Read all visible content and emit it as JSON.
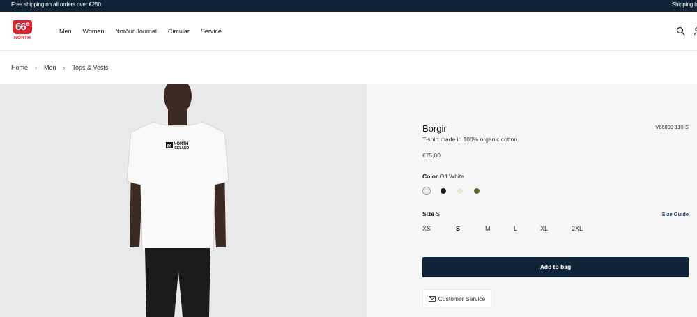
{
  "topbar": {
    "left_text": "Free shipping on all orders over €250.",
    "right_text": "Shipping to E"
  },
  "brand": {
    "logo_mark": "66°",
    "logo_word": "NORTH",
    "accent": "#d7262f",
    "navy": "#0e2238"
  },
  "nav": {
    "items": [
      "Men",
      "Women",
      "Norður Journal",
      "Circular",
      "Service"
    ]
  },
  "header_icons": [
    "search-icon",
    "user-icon"
  ],
  "breadcrumb": {
    "items": [
      "Home",
      "Men",
      "Tops & Vests"
    ],
    "separator": "›"
  },
  "product": {
    "name": "Borgir",
    "sku": "V66099-110-S",
    "description": "T-shirt made in 100% organic cotton.",
    "price": "€75,00",
    "color_label": "Color",
    "color_value": "Off White",
    "swatches": [
      {
        "name": "Off White",
        "hex": "#f2f0ea",
        "selected": true
      },
      {
        "name": "Black",
        "hex": "#1f1f1f",
        "selected": false
      },
      {
        "name": "Cream",
        "hex": "#ece6d2",
        "selected": false
      },
      {
        "name": "Olive",
        "hex": "#5a6b2e",
        "selected": false
      }
    ],
    "size_label": "Size",
    "size_value": "S",
    "size_guide": "Size Guide",
    "sizes": [
      "XS",
      "S",
      "M",
      "L",
      "XL",
      "2XL"
    ],
    "selected_size": "S"
  },
  "actions": {
    "add_to_bag": "Add to bag",
    "customer_service": "Customer Service"
  },
  "tshirt_print": {
    "line1": "NORTH",
    "line2": "ICELAND",
    "mark": "66"
  }
}
